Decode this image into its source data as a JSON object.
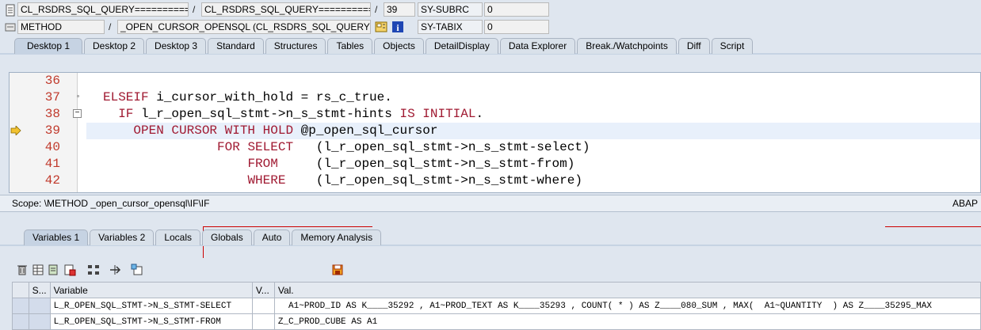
{
  "header": {
    "row1": {
      "field1": "CL_RSDRS_SQL_QUERY============...",
      "sep1": "/",
      "field2": "CL_RSDRS_SQL_QUERY============...",
      "sep2": "/",
      "line": "39",
      "sysvar": "SY-SUBRC",
      "sysval": "0"
    },
    "row2": {
      "field1": "METHOD",
      "sep1": "/",
      "field2": "_OPEN_CURSOR_OPENSQL (CL_RSDRS_SQL_QUERY)",
      "sysvar": "SY-TABIX",
      "sysval": "0"
    }
  },
  "top_tabs": [
    "Desktop 1",
    "Desktop 2",
    "Desktop 3",
    "Standard",
    "Structures",
    "Tables",
    "Objects",
    "DetailDisplay",
    "Data Explorer",
    "Break./Watchpoints",
    "Diff",
    "Script"
  ],
  "code": {
    "lines": [
      {
        "no": "36",
        "text": ""
      },
      {
        "no": "37",
        "text": "ELSEIF i_cursor_with_hold = rs_c_true."
      },
      {
        "no": "38",
        "text": "  IF l_r_open_sql_stmt->n_s_stmt-hints IS INITIAL."
      },
      {
        "no": "39",
        "text": "    OPEN CURSOR WITH HOLD @p_open_sql_cursor"
      },
      {
        "no": "40",
        "text": "               FOR SELECT   (l_r_open_sql_stmt->n_s_stmt-select)"
      },
      {
        "no": "41",
        "text": "                   FROM     (l_r_open_sql_stmt->n_s_stmt-from)"
      },
      {
        "no": "42",
        "text": "                   WHERE    (l_r_open_sql_stmt->n_s_stmt-where)"
      }
    ]
  },
  "scope": {
    "label": "Scope: \\METHOD _open_cursor_opensql\\IF\\IF",
    "lang": "ABAP"
  },
  "lower_tabs": [
    "Variables 1",
    "Variables 2",
    "Locals",
    "Globals",
    "Auto",
    "Memory Analysis"
  ],
  "grid": {
    "headers": [
      "S...",
      "Variable",
      "V...",
      "Val."
    ],
    "rows": [
      {
        "variable": "L_R_OPEN_SQL_STMT->N_S_STMT-SELECT",
        "value": "  A1~PROD_ID AS K____35292 , A1~PROD_TEXT AS K____35293 , COUNT( * ) AS Z____080_SUM , MAX(  A1~QUANTITY  ) AS Z____35295_MAX"
      },
      {
        "variable": "L_R_OPEN_SQL_STMT->N_S_STMT-FROM",
        "value": "Z_C_PROD_CUBE AS A1"
      }
    ]
  },
  "colors": {
    "keyword": "#a01a32",
    "line_number": "#c0392b",
    "accent_red": "#cc0000"
  }
}
